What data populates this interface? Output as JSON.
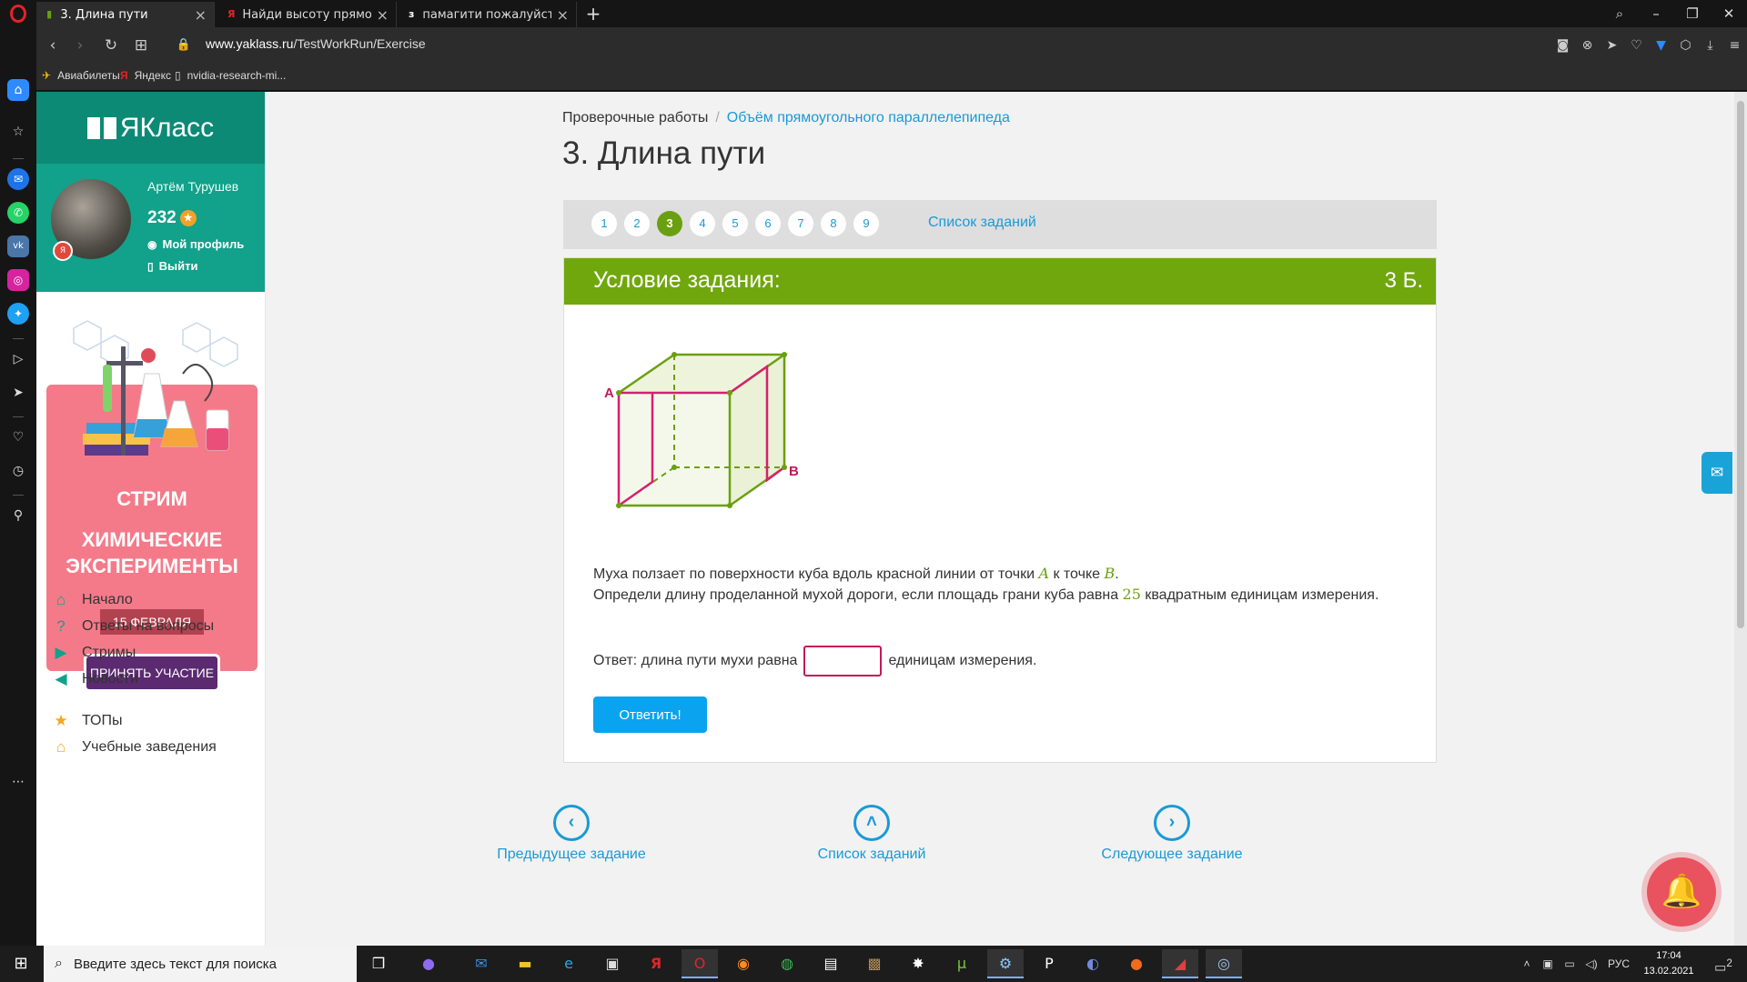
{
  "browser": {
    "tabs": [
      {
        "title": "3. Длина пути",
        "active": true,
        "favicon": "yaklass-icon"
      },
      {
        "title": "Найди высоту прямоугол...",
        "active": false,
        "favicon": "yandex-icon"
      },
      {
        "title": "памагити пожалуйста про...",
        "active": false,
        "favicon": "znanija-icon"
      }
    ],
    "url_host": "www.yaklass.ru",
    "url_path": "/TestWorkRun/Exercise",
    "bookmarks": [
      {
        "label": "Авиабилеты",
        "icon": "plane-icon"
      },
      {
        "label": "Яндекс",
        "icon": "yandex-icon"
      },
      {
        "label": "nvidia-research-mi...",
        "icon": "page-icon"
      }
    ]
  },
  "sidebar": {
    "logo": "ЯКласс",
    "user": {
      "name": "Артём Турушев",
      "points": "232",
      "profile_link": "Мой профиль",
      "logout_link": "Выйти"
    },
    "promo": {
      "line1": "СТРИМ",
      "line2": "ХИМИЧЕСКИЕ ЭКСПЕРИМЕНТЫ",
      "date": "15 ФЕВРАЛЯ",
      "button": "ПРИНЯТЬ УЧАСТИЕ"
    },
    "menu": [
      {
        "label": "Начало",
        "icon": "home-icon"
      },
      {
        "label": "Ответы на вопросы",
        "icon": "question-icon"
      },
      {
        "label": "Стримы",
        "icon": "video-icon"
      },
      {
        "label": "Новости",
        "icon": "megaphone-icon"
      },
      {
        "label": "ТОПы",
        "icon": "star-icon"
      },
      {
        "label": "Учебные заведения",
        "icon": "school-icon"
      }
    ]
  },
  "main": {
    "breadcrumb": {
      "root": "Проверочные работы",
      "current": "Объём прямоугольного параллелепипеда"
    },
    "title": "3. Длина пути",
    "pager": {
      "pages": [
        "1",
        "2",
        "3",
        "4",
        "5",
        "6",
        "7",
        "8",
        "9"
      ],
      "current": "3",
      "list_link": "Список заданий"
    },
    "task": {
      "header": "Условие задания:",
      "points": "3 Б.",
      "figure": {
        "label_a": "A",
        "label_b": "B"
      },
      "text_part1": "Муха ползает по поверхности куба вдоль красной линии от точки ",
      "var_a": "A",
      "text_part2": " к точке ",
      "var_b": "B",
      "text_part3": ".",
      "text_line2_part1": "Определи длину проделанной мухой дороги, если площадь грани куба равна ",
      "area": "25",
      "text_line2_part2": " квадратным единицам измерения.",
      "answer_prefix": "Ответ: длина пути мухи равна",
      "answer_value": "",
      "answer_suffix": "единицам измерения.",
      "submit": "Ответить!"
    },
    "nav": {
      "prev": "Предыдущее задание",
      "list": "Список заданий",
      "next": "Следующее задание"
    }
  },
  "taskbar": {
    "search_placeholder": "Введите здесь текст для поиска",
    "lang": "РУС",
    "time": "17:04",
    "date": "13.02.2021",
    "notifications": "2"
  },
  "colors": {
    "accent_green": "#70a70d",
    "teal": "#12a18a",
    "link_blue": "#1a9ad6",
    "path_red": "#d6206f"
  }
}
